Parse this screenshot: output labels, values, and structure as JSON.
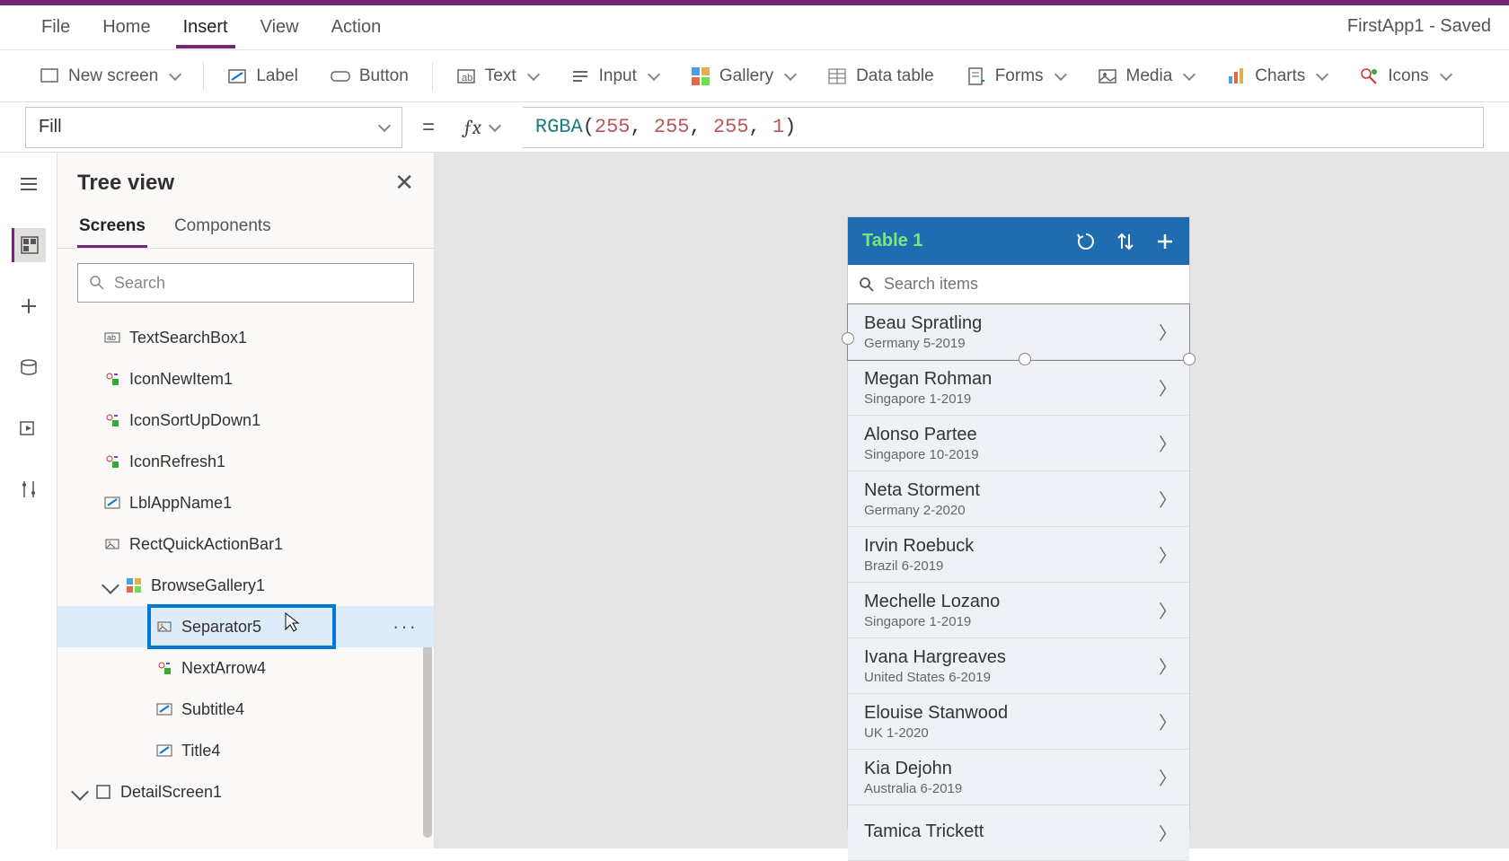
{
  "app_title": "FirstApp1 - Saved",
  "menu": [
    "File",
    "Home",
    "Insert",
    "View",
    "Action"
  ],
  "menu_active": "Insert",
  "ribbon": {
    "new_screen": "New screen",
    "label": "Label",
    "button": "Button",
    "text": "Text",
    "input": "Input",
    "gallery": "Gallery",
    "data_table": "Data table",
    "forms": "Forms",
    "media": "Media",
    "charts": "Charts",
    "icons": "Icons"
  },
  "property": "Fill",
  "formula": {
    "fn": "RGBA",
    "args": [
      "255",
      "255",
      "255",
      "1"
    ]
  },
  "tree": {
    "title": "Tree view",
    "tabs": [
      "Screens",
      "Components"
    ],
    "search_placeholder": "Search",
    "nodes": [
      {
        "depth": 1,
        "label": "TextSearchBox1",
        "icon": "textbox"
      },
      {
        "depth": 1,
        "label": "IconNewItem1",
        "icon": "icon"
      },
      {
        "depth": 1,
        "label": "IconSortUpDown1",
        "icon": "icon"
      },
      {
        "depth": 1,
        "label": "IconRefresh1",
        "icon": "icon"
      },
      {
        "depth": 1,
        "label": "LblAppName1",
        "icon": "label"
      },
      {
        "depth": 1,
        "label": "RectQuickActionBar1",
        "icon": "rect"
      },
      {
        "depth": 1,
        "label": "BrowseGallery1",
        "icon": "gallery",
        "expanded": true
      },
      {
        "depth": 2,
        "label": "Separator5",
        "icon": "rect",
        "selected": true
      },
      {
        "depth": 2,
        "label": "NextArrow4",
        "icon": "icon"
      },
      {
        "depth": 2,
        "label": "Subtitle4",
        "icon": "label"
      },
      {
        "depth": 2,
        "label": "Title4",
        "icon": "label"
      },
      {
        "depth": 0,
        "label": "DetailScreen1",
        "icon": "screen",
        "expanded": true
      }
    ]
  },
  "phone": {
    "title": "Table 1",
    "search_placeholder": "Search items",
    "items": [
      {
        "title": "Beau Spratling",
        "subtitle": "Germany 5-2019"
      },
      {
        "title": "Megan Rohman",
        "subtitle": "Singapore 1-2019"
      },
      {
        "title": "Alonso Partee",
        "subtitle": "Singapore 10-2019"
      },
      {
        "title": "Neta Storment",
        "subtitle": "Germany 2-2020"
      },
      {
        "title": "Irvin Roebuck",
        "subtitle": "Brazil 6-2019"
      },
      {
        "title": "Mechelle Lozano",
        "subtitle": "Singapore 1-2019"
      },
      {
        "title": "Ivana Hargreaves",
        "subtitle": "United States 6-2019"
      },
      {
        "title": "Elouise Stanwood",
        "subtitle": "UK 1-2020"
      },
      {
        "title": "Kia Dejohn",
        "subtitle": "Australia 6-2019"
      },
      {
        "title": "Tamica Trickett",
        "subtitle": ""
      }
    ]
  }
}
